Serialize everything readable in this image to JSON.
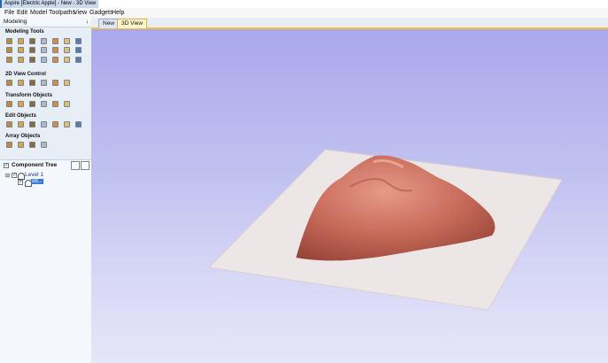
{
  "window": {
    "title": "Aspire [Electric Apple] - New - 3D View"
  },
  "menu": [
    "File",
    "Edit",
    "Model",
    "Toolpaths",
    "View",
    "Gadgets",
    "Help"
  ],
  "tabs": [
    {
      "label": "New"
    },
    {
      "label": "3D View"
    }
  ],
  "panel": {
    "title": "Modeling",
    "pin": "↓"
  },
  "sections": {
    "modeling_tools": "Modeling Tools",
    "view_control_2d": "2D View Control",
    "transform_objects": "Transform Objects",
    "edit_objects": "Edit Objects",
    "array_objects": "Array Objects"
  },
  "component_tree": {
    "title": "Component Tree",
    "level": "Level 1",
    "item": "ob..."
  },
  "colors": {
    "accent": "#f0c040",
    "viewport_top": "#a9a9ed",
    "viewport_bottom": "#e6e6f9",
    "model": "#c86a5a",
    "plate": "#ece6e6"
  }
}
